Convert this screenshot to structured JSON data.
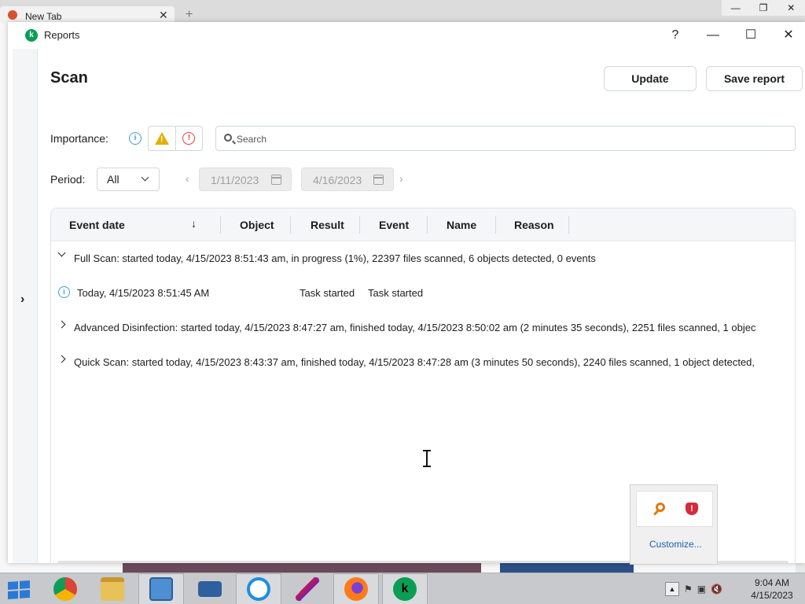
{
  "browser": {
    "tab_title": "New Tab",
    "tab_close": "✕",
    "new_tab": "+",
    "controls": [
      "—",
      "❐",
      "✕"
    ]
  },
  "window": {
    "title": "Reports",
    "help": "?",
    "minimize": "—",
    "maximize": "☐",
    "close": "✕",
    "app_icon_letter": "k"
  },
  "sidebar": {
    "expand": "›"
  },
  "page": {
    "title": "Scan"
  },
  "toolbar": {
    "update_label": "Update",
    "save_report_label": "Save report"
  },
  "filters": {
    "importance_label": "Importance:",
    "info_glyph": "i",
    "warning_glyph": "!",
    "error_glyph": "!",
    "search_placeholder": "Search",
    "period_label": "Period:",
    "period_value": "All",
    "date_from": "1/11/2023",
    "date_to": "4/16/2023",
    "prev": "‹",
    "next": "›"
  },
  "table": {
    "columns": [
      "Event date",
      "Object",
      "Result",
      "Event",
      "Name",
      "Reason"
    ],
    "sort_indicator": "↓",
    "rows": [
      {
        "type": "group",
        "expanded": true,
        "text": "Full Scan: started today, 4/15/2023 8:51:43 am, in progress (1%), 22397 files scanned, 6 objects detected, 0 events"
      },
      {
        "type": "event",
        "date": "Today, 4/15/2023 8:51:45 AM",
        "result": "Task started",
        "event": "Task started"
      },
      {
        "type": "group",
        "expanded": false,
        "text": "Advanced Disinfection: started today, 4/15/2023 8:47:27 am, finished today, 4/15/2023 8:50:02 am (2 minutes 35 seconds), 2251 files scanned, 1 objec"
      },
      {
        "type": "group",
        "expanded": false,
        "text": "Quick Scan: started today, 4/15/2023 8:43:37 am, finished today, 4/15/2023 8:47:28 am (3 minutes 50 seconds), 2240 files scanned, 1 object detected,"
      }
    ]
  },
  "tray_popup": {
    "customize_label": "Customize...",
    "shield_glyph": "!"
  },
  "taskbar": {
    "time": "9:04 AM",
    "date": "4/15/2023",
    "tray_up": "▲",
    "app_icon_letter": "k",
    "items": [
      "start",
      "chrome",
      "file-explorer",
      "control-panel",
      "keyboard",
      "internet-explorer",
      "feather",
      "firefox",
      "kaspersky"
    ]
  },
  "colors": {
    "accent_green": "#0a9e55",
    "info_blue": "#3aa0d8",
    "warning_yellow": "#e2b000",
    "error_red": "#e0403a",
    "link_blue": "#1a5fb4"
  }
}
